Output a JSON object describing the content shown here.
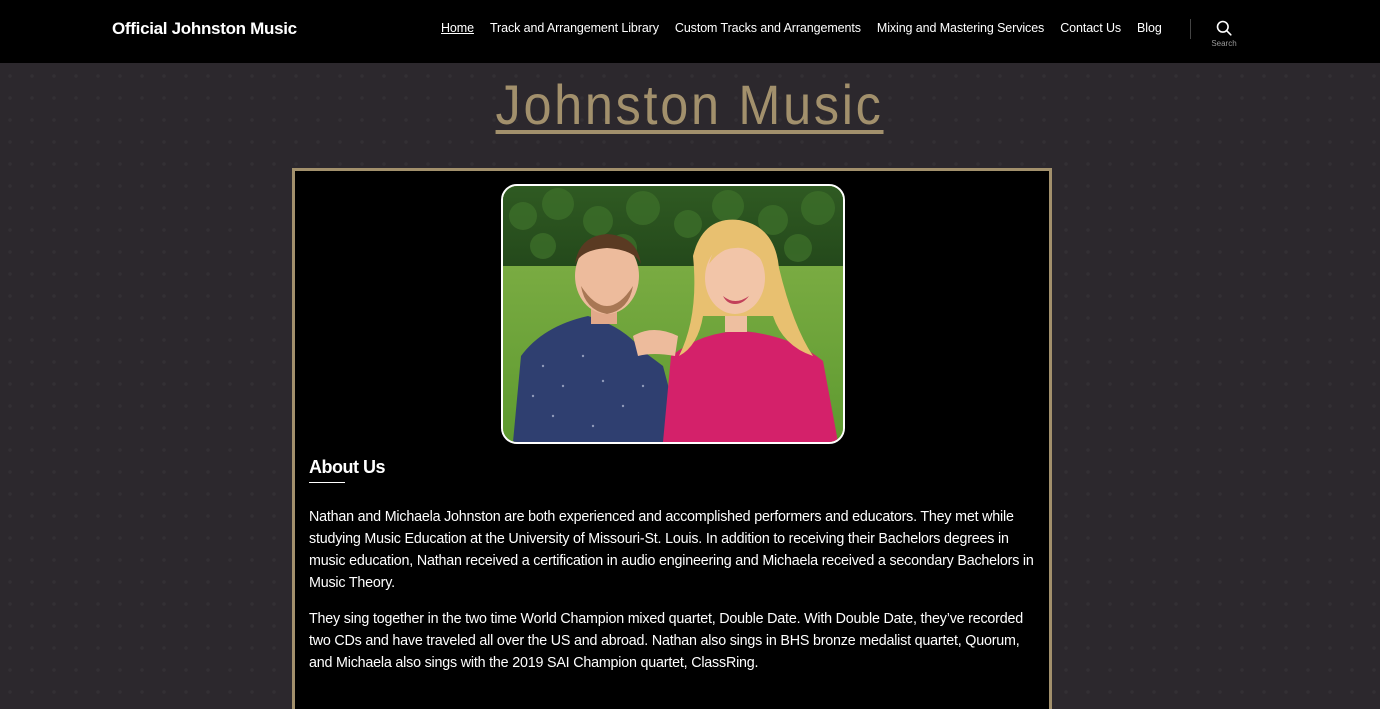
{
  "header": {
    "site_title": "Official Johnston Music",
    "nav": [
      {
        "label": "Home",
        "active": true
      },
      {
        "label": "Track and Arrangement Library",
        "active": false
      },
      {
        "label": "Custom Tracks and Arrangements",
        "active": false
      },
      {
        "label": "Mixing and Mastering Services",
        "active": false
      },
      {
        "label": "Contact Us",
        "active": false
      },
      {
        "label": "Blog",
        "active": false
      }
    ],
    "search_label": "Search",
    "search_icon": "search-icon"
  },
  "hero": {
    "title": "Johnston Music"
  },
  "about": {
    "heading": "About Us",
    "paragraphs": [
      "Nathan and Michaela Johnston are both experienced and accomplished performers and educators. They met while studying Music Education at the University of Missouri-St. Louis. In addition to receiving their Bachelors degrees in music education, Nathan received a certification in audio engineering and Michaela received a secondary Bachelors in Music Theory.",
      "They sing together in the two time World Champion mixed quartet, Double Date. With Double Date, they’ve recorded two CDs and have traveled all over the US and abroad. Nathan also sings in BHS bronze medalist quartet, Quorum, and Michaela also sings with the 2019 SAI Champion quartet, ClassRing."
    ]
  },
  "colors": {
    "accent": "#a2906c",
    "header_bg": "#000000",
    "page_bg": "#2c282d",
    "panel_bg": "#000000",
    "text": "#ffffff"
  }
}
